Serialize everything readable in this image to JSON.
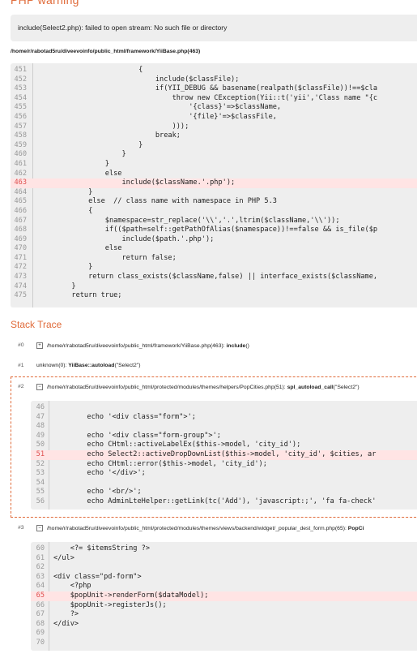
{
  "warning": {
    "title": "PHP warning",
    "message": "include(Select2.php): failed to open stream: No such file or directory",
    "file_path": "/home/r/rabotad5ru/diveevoinfo/public_html/framework/YiiBase.php(463)"
  },
  "source": {
    "numbers": [
      "451",
      "452",
      "453",
      "454",
      "455",
      "456",
      "457",
      "458",
      "459",
      "460",
      "461",
      "462",
      "463",
      "464",
      "465",
      "466",
      "467",
      "468",
      "469",
      "470",
      "471",
      "472",
      "473",
      "474",
      "475"
    ],
    "lines": [
      "                        {",
      "                            include($classFile);",
      "                            if(YII_DEBUG && basename(realpath($classFile))!==$cla",
      "                                throw new CException(Yii::t('yii','Class name \"{c",
      "                                    '{class}'=>$className,",
      "                                    '{file}'=>$classFile,",
      "                                )));",
      "                            break;",
      "                        }",
      "                    }",
      "                }",
      "                else",
      "                    include($className.'.php');",
      "            }",
      "            else  // class name with namespace in PHP 5.3",
      "            {",
      "                $namespace=str_replace('\\\\','.',ltrim($className,'\\\\'));",
      "                if(($path=self::getPathOfAlias($namespace))!==false && is_file($p",
      "                    include($path.'.php');",
      "                else",
      "                    return false;",
      "            }",
      "            return class_exists($className,false) || interface_exists($className,",
      "        }",
      "        return true;"
    ]
  },
  "stack": {
    "title": "Stack Trace",
    "t0": {
      "num": "#0",
      "toggle": "+",
      "path": "/home/r/rabotad5ru/diveevoinfo/public_html/framework/YiiBase.php(463):",
      "func": "include",
      "args": "()"
    },
    "t1": {
      "num": "#1",
      "prefix": "unknown(0):",
      "func": "YiiBase::autoload",
      "args": "(\"Select2\")"
    },
    "t2": {
      "num": "#2",
      "toggle": "−",
      "path": "/home/r/rabotad5ru/diveevoinfo/public_html/protected/modules/themes/helpers/PopCities.php(51):",
      "func": "spl_autoload_call",
      "args": "(\"Select2\")",
      "numbers": [
        "46",
        "47",
        "48",
        "49",
        "50",
        "51",
        "52",
        "53",
        "54",
        "55",
        "56"
      ],
      "lines": [
        "",
        "        echo '<div class=\"form\">';",
        "",
        "        echo '<div class=\"form-group\">';",
        "        echo CHtml::activeLabelEx($this->model, 'city_id');",
        "        echo Select2::activeDropDownList($this->model, 'city_id', $cities, ar",
        "        echo CHtml::error($this->model, 'city_id');",
        "        echo '</div>';",
        "",
        "        echo '<br/>';",
        "        echo AdminLteHelper::getLink(tc('Add'), 'javascript:;', 'fa fa-check'"
      ]
    },
    "t3": {
      "num": "#3",
      "toggle": "−",
      "path": "/home/r/rabotad5ru/diveevoinfo/public_html/protected/modules/themes/views/backend/widget/_popular_dest_form.php(65):",
      "func": "PopCi",
      "numbers": [
        "60",
        "61",
        "62",
        "63",
        "64",
        "65",
        "66",
        "67",
        "68",
        "69",
        "70"
      ],
      "lines": [
        "    <?= $itemsString ?>",
        "</ul>",
        "",
        "<div class=\"pd-form\">",
        "    <?php",
        "    $popUnit->renderForm($dataModel);",
        "    $popUnit->registerJs();",
        "    ?>",
        "</div>",
        "",
        ""
      ]
    }
  }
}
